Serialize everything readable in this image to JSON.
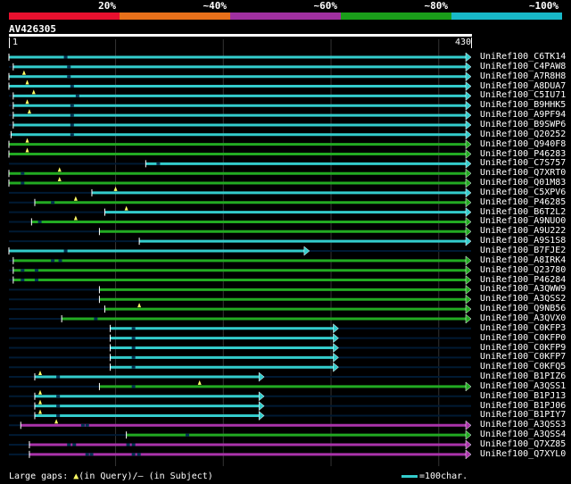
{
  "legend": {
    "segments": [
      {
        "label": "20%",
        "color": "#e8102e"
      },
      {
        "label": "~40%",
        "color": "#e8701a"
      },
      {
        "label": "~60%",
        "color": "#a030a0"
      },
      {
        "label": "~80%",
        "color": "#1a9e1a"
      },
      {
        "label": "~100%",
        "color": "#18b8c8"
      }
    ]
  },
  "query": {
    "id": "AV426305",
    "start": "1",
    "end": "430",
    "length": 430
  },
  "colors": {
    "cyan": "#33cccc",
    "green": "#22aa22",
    "purple": "#aa33aa",
    "gap": "#224488"
  },
  "hits": [
    {
      "name": "UniRef100_C6TK14",
      "start": 1,
      "end": 430,
      "color": "cyan",
      "gaps": [
        52
      ]
    },
    {
      "name": "UniRef100_C4PAW8",
      "start": 5,
      "end": 430,
      "color": "cyan",
      "gaps": [
        55
      ]
    },
    {
      "name": "UniRef100_A7R8H8",
      "start": 1,
      "end": 430,
      "color": "cyan",
      "gaps": [
        55
      ],
      "q_gaps": [
        15
      ]
    },
    {
      "name": "UniRef100_A8DUA7",
      "start": 1,
      "end": 430,
      "color": "cyan",
      "gaps": [
        58
      ],
      "q_gaps": [
        18
      ]
    },
    {
      "name": "UniRef100_C5IU71",
      "start": 5,
      "end": 430,
      "color": "cyan",
      "gaps": [
        63
      ],
      "q_gaps": [
        24
      ]
    },
    {
      "name": "UniRef100_B9HHK5",
      "start": 5,
      "end": 430,
      "color": "cyan",
      "gaps": [
        58
      ],
      "q_gaps": [
        18
      ]
    },
    {
      "name": "UniRef100_A9PF94",
      "start": 5,
      "end": 430,
      "color": "cyan",
      "gaps": [
        58
      ],
      "q_gaps": [
        20
      ]
    },
    {
      "name": "UniRef100_B9SWP6",
      "start": 5,
      "end": 430,
      "color": "cyan",
      "gaps": [
        58
      ]
    },
    {
      "name": "UniRef100_Q20252",
      "start": 3,
      "end": 430,
      "color": "cyan",
      "gaps": [
        58
      ]
    },
    {
      "name": "UniRef100_Q940F8",
      "start": 1,
      "end": 430,
      "color": "green",
      "gaps": [],
      "q_gaps": [
        18
      ]
    },
    {
      "name": "UniRef100_P46283",
      "start": 1,
      "end": 430,
      "color": "green",
      "gaps": [],
      "q_gaps": [
        18
      ]
    },
    {
      "name": "UniRef100_C7S757",
      "start": 128,
      "end": 430,
      "color": "cyan",
      "gaps": [
        138
      ]
    },
    {
      "name": "UniRef100_Q7XRT0",
      "start": 1,
      "end": 430,
      "color": "green",
      "gaps": [
        12
      ],
      "q_gaps": [
        48
      ]
    },
    {
      "name": "UniRef100_Q01M83",
      "start": 1,
      "end": 430,
      "color": "green",
      "gaps": [
        12
      ],
      "q_gaps": [
        48
      ]
    },
    {
      "name": "UniRef100_C5XPV6",
      "start": 78,
      "end": 430,
      "color": "cyan",
      "gaps": [],
      "q_gaps": [
        100
      ]
    },
    {
      "name": "UniRef100_P46285",
      "start": 25,
      "end": 430,
      "color": "green",
      "gaps": [
        40
      ],
      "q_gaps": [
        63
      ]
    },
    {
      "name": "UniRef100_B6T2L2",
      "start": 90,
      "end": 430,
      "color": "cyan",
      "gaps": [],
      "q_gaps": [
        110
      ]
    },
    {
      "name": "UniRef100_A9NUO0",
      "start": 22,
      "end": 430,
      "color": "green",
      "gaps": [
        28
      ],
      "q_gaps": [
        63
      ]
    },
    {
      "name": "UniRef100_A9U222",
      "start": 85,
      "end": 430,
      "color": "green",
      "gaps": [],
      "q_gaps": []
    },
    {
      "name": "UniRef100_A9S1S8",
      "start": 122,
      "end": 430,
      "color": "cyan",
      "gaps": []
    },
    {
      "name": "UniRef100_B7FJE2",
      "start": 1,
      "end": 280,
      "color": "cyan",
      "gaps": [
        52
      ]
    },
    {
      "name": "UniRef100_A8IRK4",
      "start": 5,
      "end": 430,
      "color": "green",
      "gaps": [
        40,
        47
      ]
    },
    {
      "name": "UniRef100_Q23780",
      "start": 5,
      "end": 430,
      "color": "green",
      "gaps": [
        12,
        25
      ]
    },
    {
      "name": "UniRef100_P46284",
      "start": 5,
      "end": 430,
      "color": "green",
      "gaps": [
        12,
        25
      ]
    },
    {
      "name": "UniRef100_A3QWW9",
      "start": 85,
      "end": 430,
      "color": "green",
      "gaps": []
    },
    {
      "name": "UniRef100_A3QSS2",
      "start": 85,
      "end": 430,
      "color": "green",
      "gaps": []
    },
    {
      "name": "UniRef100_Q9NB56",
      "start": 90,
      "end": 430,
      "color": "green",
      "gaps": [],
      "q_gaps": [
        122
      ]
    },
    {
      "name": "UniRef100_A3QVX0",
      "start": 50,
      "end": 430,
      "color": "green",
      "gaps": [
        80
      ]
    },
    {
      "name": "UniRef100_C0KFP3",
      "start": 95,
      "end": 307,
      "color": "cyan",
      "gaps": [
        115
      ]
    },
    {
      "name": "UniRef100_C0KFP0",
      "start": 95,
      "end": 307,
      "color": "cyan",
      "gaps": [
        115
      ]
    },
    {
      "name": "UniRef100_C0KFP9",
      "start": 95,
      "end": 307,
      "color": "cyan",
      "gaps": [
        115
      ]
    },
    {
      "name": "UniRef100_C0KFP7",
      "start": 95,
      "end": 307,
      "color": "cyan",
      "gaps": [
        115
      ]
    },
    {
      "name": "UniRef100_C0KFQ5",
      "start": 95,
      "end": 307,
      "color": "cyan",
      "gaps": [
        115
      ]
    },
    {
      "name": "UniRef100_B1PIZ6",
      "start": 25,
      "end": 238,
      "color": "cyan",
      "gaps": [
        45
      ],
      "q_gaps": [
        30
      ]
    },
    {
      "name": "UniRef100_A3QSS1",
      "start": 85,
      "end": 430,
      "color": "green",
      "gaps": [
        115
      ],
      "q_gaps": [
        178
      ]
    },
    {
      "name": "UniRef100_B1PJ13",
      "start": 25,
      "end": 238,
      "color": "cyan",
      "gaps": [
        45
      ],
      "q_gaps": [
        30
      ]
    },
    {
      "name": "UniRef100_B1PJ06",
      "start": 25,
      "end": 238,
      "color": "cyan",
      "gaps": [
        45
      ],
      "q_gaps": [
        30
      ]
    },
    {
      "name": "UniRef100_B1PIY7",
      "start": 25,
      "end": 238,
      "color": "cyan",
      "gaps": [
        45
      ],
      "q_gaps": [
        30
      ]
    },
    {
      "name": "UniRef100_A3QSS3",
      "start": 12,
      "end": 430,
      "color": "purple",
      "gaps": [
        68,
        72
      ],
      "q_gaps": [
        45
      ]
    },
    {
      "name": "UniRef100_A3QSS4",
      "start": 110,
      "end": 430,
      "color": "green",
      "gaps": [
        165
      ]
    },
    {
      "name": "UniRef100_Q7XZ85",
      "start": 20,
      "end": 430,
      "color": "purple",
      "gaps": [
        55,
        60,
        110,
        115
      ]
    },
    {
      "name": "UniRef100_Q7XYL0",
      "start": 20,
      "end": 430,
      "color": "purple",
      "gaps": [
        72,
        76,
        115,
        120
      ]
    }
  ],
  "footer": {
    "text": "Large gaps: ",
    "q_mark": "▲",
    "q_text": "(in Query)/",
    "s_mark": "—",
    "s_text": " (in Subject)",
    "scale_text": "=100char."
  }
}
